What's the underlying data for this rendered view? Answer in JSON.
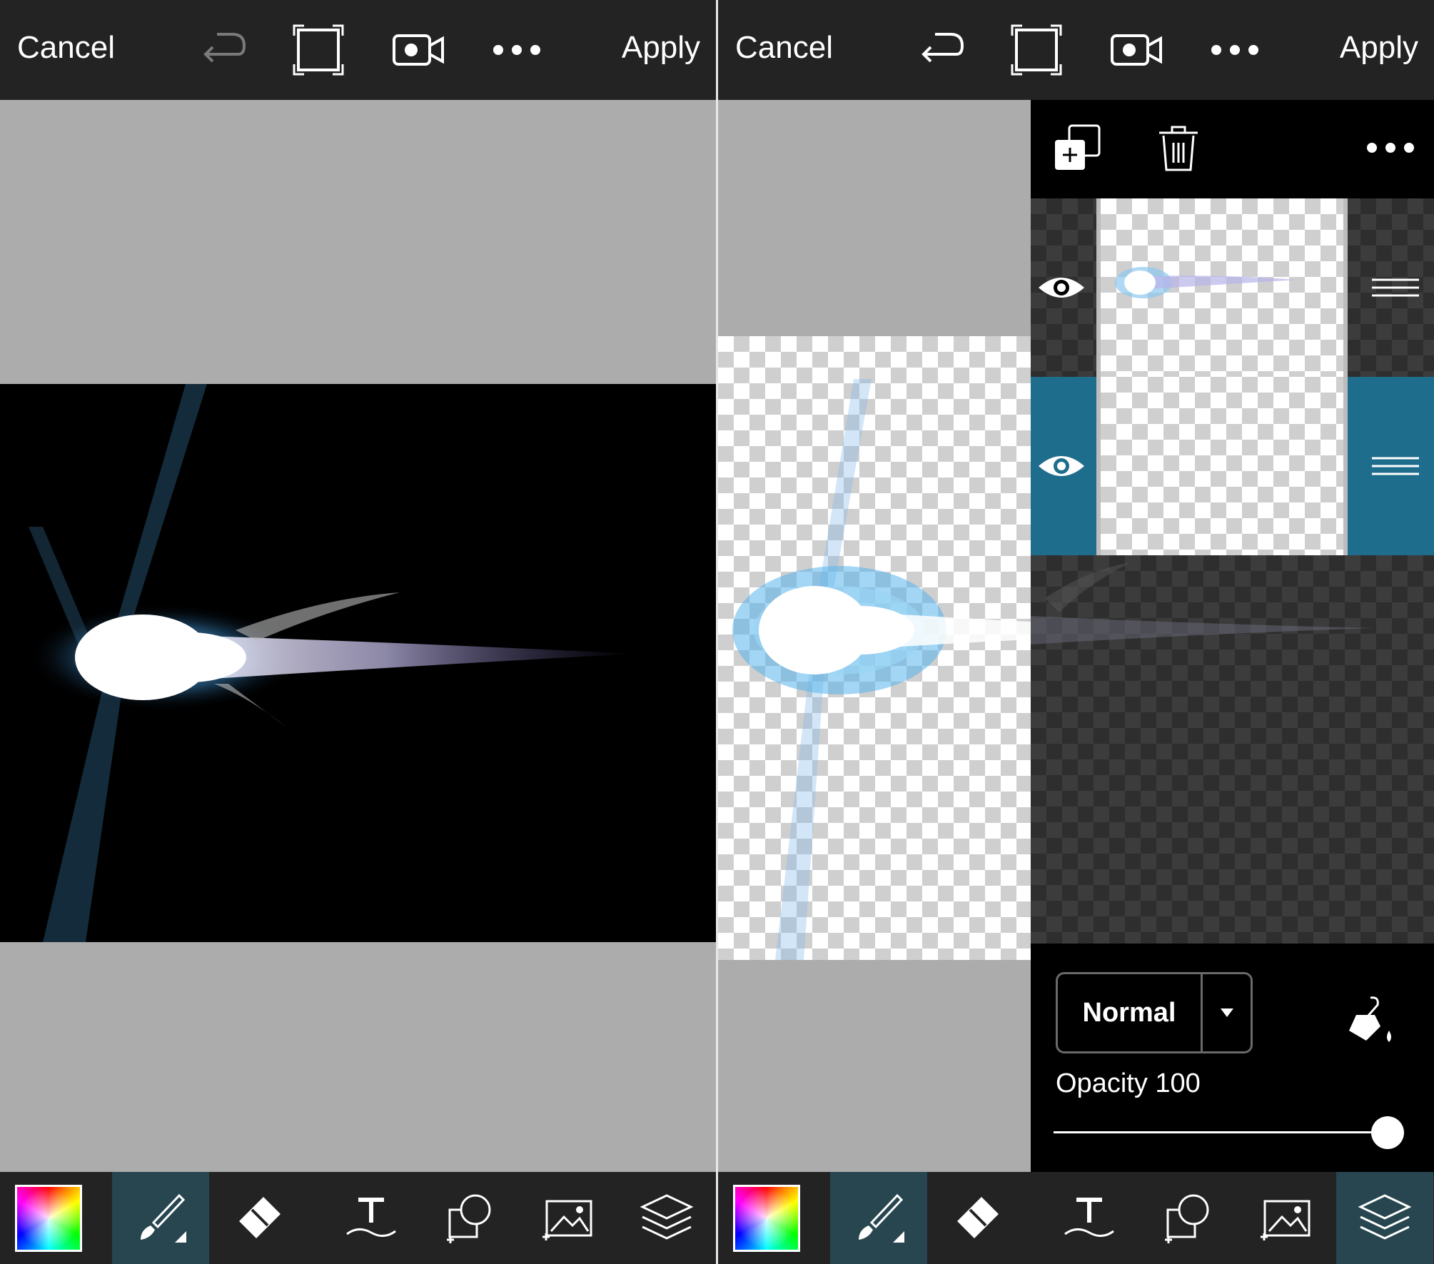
{
  "topbar": {
    "cancel_label": "Cancel",
    "apply_label": "Apply",
    "icons": [
      "undo-icon",
      "crop-frame-icon",
      "video-camera-icon",
      "more-icon"
    ]
  },
  "toolbar": {
    "tools": [
      "color-picker",
      "brush",
      "eraser",
      "text",
      "shape",
      "image",
      "layers"
    ],
    "left_active": "brush",
    "right_active": [
      "brush",
      "layers"
    ]
  },
  "layers_panel": {
    "header_icons": [
      "add-layer-icon",
      "trash-icon",
      "more-icon"
    ],
    "layers": [
      {
        "visible": true,
        "selected": false
      },
      {
        "visible": true,
        "selected": true
      }
    ],
    "blend_mode": "Normal",
    "opacity_label": "Opacity 100",
    "opacity_value": 100
  },
  "colors": {
    "accent": "#1f6d8c",
    "bar_bg": "#232323",
    "canvas_bg": "#acacac",
    "active_tool": "#274650"
  }
}
